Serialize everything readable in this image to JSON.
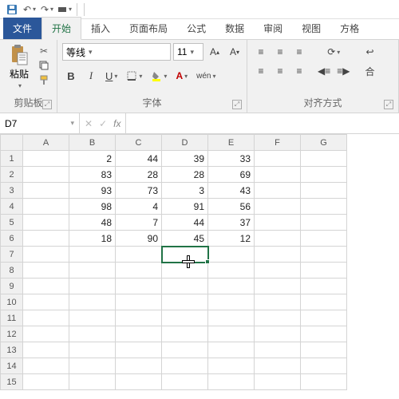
{
  "qat": {
    "save": "保存",
    "undo": "撤销",
    "redo": "重做"
  },
  "tabs": {
    "file": "文件",
    "home": "开始",
    "insert": "插入",
    "layout": "页面布局",
    "formulas": "公式",
    "data": "数据",
    "review": "审阅",
    "view": "视图",
    "dev": "方格"
  },
  "ribbon": {
    "clipboard": {
      "label": "剪贴板",
      "paste": "粘贴"
    },
    "font": {
      "label": "字体",
      "family": "等线",
      "size": "11",
      "bold": "B",
      "italic": "I",
      "underline": "U",
      "wen": "wén"
    },
    "align": {
      "label": "对齐方式",
      "merge": "合"
    }
  },
  "namebox": "D7",
  "formula": "",
  "cols": [
    "A",
    "B",
    "C",
    "D",
    "E",
    "F",
    "G"
  ],
  "rows": [
    "1",
    "2",
    "3",
    "4",
    "5",
    "6",
    "7",
    "8",
    "9",
    "10",
    "11",
    "12",
    "13",
    "14",
    "15"
  ],
  "cells": {
    "B1": "2",
    "C1": "44",
    "D1": "39",
    "E1": "33",
    "B2": "83",
    "C2": "28",
    "D2": "28",
    "E2": "69",
    "B3": "93",
    "C3": "73",
    "D3": "3",
    "E3": "43",
    "B4": "98",
    "C4": "4",
    "D4": "91",
    "E4": "56",
    "B5": "48",
    "C5": "7",
    "D5": "44",
    "E5": "37",
    "B6": "18",
    "C6": "90",
    "D6": "45",
    "E6": "12"
  },
  "selected": "D7",
  "chart_data": {
    "type": "table",
    "title": "",
    "columns": [
      "B",
      "C",
      "D",
      "E"
    ],
    "rows": [
      [
        2,
        44,
        39,
        33
      ],
      [
        83,
        28,
        28,
        69
      ],
      [
        93,
        73,
        3,
        43
      ],
      [
        98,
        4,
        91,
        56
      ],
      [
        48,
        7,
        44,
        37
      ],
      [
        18,
        90,
        45,
        12
      ]
    ]
  }
}
